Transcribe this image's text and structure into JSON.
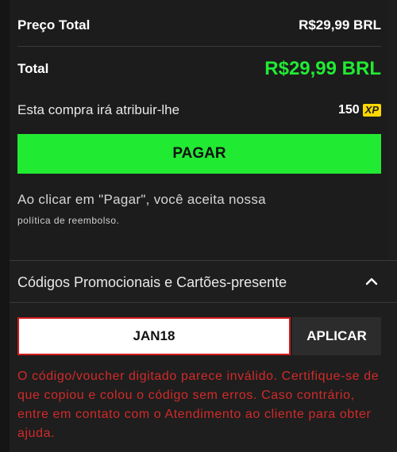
{
  "summary": {
    "subtotal_label": "Preço Total",
    "subtotal_value": "R$29,99 BRL",
    "total_label": "Total",
    "total_value": "R$29,99 BRL",
    "xp_text": "Esta compra irá atribuir-lhe",
    "xp_amount": "150",
    "xp_badge": "XP",
    "pay_label": "PAGAR",
    "terms_line1": "Ao clicar em \"Pagar\", você aceita nossa",
    "terms_line2": "política de reembolso."
  },
  "promo": {
    "title": "Códigos Promocionais e Cartões-presente",
    "code_value": "JAN18",
    "apply_label": "APLICAR",
    "error_message": "O código/voucher digitado parece inválido. Certifique-se de que copiou e colou o código sem erros. Caso contrário, entre em contato com o Atendimento ao cliente para obter ajuda."
  },
  "colors": {
    "accent_green": "#21ea33",
    "error_red": "#d42a2a",
    "xp_yellow": "#ffd800",
    "background": "#1e1e1e"
  },
  "icons": {
    "collapse": "chevron-up-icon"
  }
}
